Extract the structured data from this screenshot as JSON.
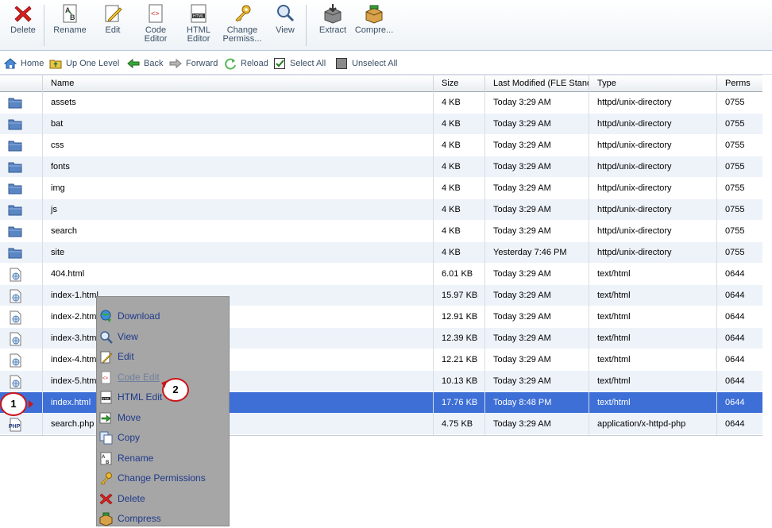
{
  "toolbar": {
    "buttons": [
      {
        "key": "delete",
        "label": "Delete",
        "icon": "red-x-icon"
      },
      {
        "key": "rename",
        "label": "Rename",
        "icon": "rename-ab-icon"
      },
      {
        "key": "edit",
        "label": "Edit",
        "icon": "pencil-page-icon"
      },
      {
        "key": "code-editor",
        "label1": "Code",
        "label2": "Editor",
        "icon": "code-page-icon"
      },
      {
        "key": "html-editor",
        "label1": "HTML",
        "label2": "Editor",
        "icon": "html-page-icon"
      },
      {
        "key": "change-permissions",
        "label1": "Change",
        "label2": "Permiss...",
        "icon": "key-icon"
      },
      {
        "key": "view",
        "label": "View",
        "icon": "magnifier-icon"
      },
      {
        "key": "extract",
        "label": "Extract",
        "icon": "extract-box-icon"
      },
      {
        "key": "compress",
        "label": "Compre...",
        "icon": "compress-box-icon"
      }
    ]
  },
  "navbar": {
    "home": "Home",
    "up": "Up One Level",
    "back": "Back",
    "forward": "Forward",
    "reload": "Reload",
    "select_all": "Select All",
    "unselect_all": "Unselect All"
  },
  "table": {
    "headers": {
      "name": "Name",
      "size": "Size",
      "modified": "Last Modified (FLE Stand",
      "type": "Type",
      "perms": "Perms"
    },
    "rows": [
      {
        "name": "assets",
        "size": "4 KB",
        "modified": "Today 3:29 AM",
        "type": "httpd/unix-directory",
        "perms": "0755",
        "kind": "folder"
      },
      {
        "name": "bat",
        "size": "4 KB",
        "modified": "Today 3:29 AM",
        "type": "httpd/unix-directory",
        "perms": "0755",
        "kind": "folder"
      },
      {
        "name": "css",
        "size": "4 KB",
        "modified": "Today 3:29 AM",
        "type": "httpd/unix-directory",
        "perms": "0755",
        "kind": "folder"
      },
      {
        "name": "fonts",
        "size": "4 KB",
        "modified": "Today 3:29 AM",
        "type": "httpd/unix-directory",
        "perms": "0755",
        "kind": "folder"
      },
      {
        "name": "img",
        "size": "4 KB",
        "modified": "Today 3:29 AM",
        "type": "httpd/unix-directory",
        "perms": "0755",
        "kind": "folder"
      },
      {
        "name": "js",
        "size": "4 KB",
        "modified": "Today 3:29 AM",
        "type": "httpd/unix-directory",
        "perms": "0755",
        "kind": "folder"
      },
      {
        "name": "search",
        "size": "4 KB",
        "modified": "Today 3:29 AM",
        "type": "httpd/unix-directory",
        "perms": "0755",
        "kind": "folder"
      },
      {
        "name": "site",
        "size": "4 KB",
        "modified": "Yesterday 7:46 PM",
        "type": "httpd/unix-directory",
        "perms": "0755",
        "kind": "folder"
      },
      {
        "name": "404.html",
        "size": "6.01 KB",
        "modified": "Today 3:29 AM",
        "type": "text/html",
        "perms": "0644",
        "kind": "html"
      },
      {
        "name": "index-1.html",
        "size": "15.97 KB",
        "modified": "Today 3:29 AM",
        "type": "text/html",
        "perms": "0644",
        "kind": "html"
      },
      {
        "name": "index-2.html",
        "size": "12.91 KB",
        "modified": "Today 3:29 AM",
        "type": "text/html",
        "perms": "0644",
        "kind": "html"
      },
      {
        "name": "index-3.html",
        "size": "12.39 KB",
        "modified": "Today 3:29 AM",
        "type": "text/html",
        "perms": "0644",
        "kind": "html"
      },
      {
        "name": "index-4.html",
        "size": "12.21 KB",
        "modified": "Today 3:29 AM",
        "type": "text/html",
        "perms": "0644",
        "kind": "html"
      },
      {
        "name": "index-5.html",
        "size": "10.13 KB",
        "modified": "Today 3:29 AM",
        "type": "text/html",
        "perms": "0644",
        "kind": "html"
      },
      {
        "name": "index.html",
        "size": "17.76 KB",
        "modified": "Today 8:48 PM",
        "type": "text/html",
        "perms": "0644",
        "kind": "html",
        "selected": true
      },
      {
        "name": "search.php",
        "size": "4.75 KB",
        "modified": "Today 3:29 AM",
        "type": "application/x-httpd-php",
        "perms": "0644",
        "kind": "php"
      }
    ]
  },
  "context_menu": {
    "items": [
      {
        "key": "download",
        "label": "Download",
        "icon": "globe-download-icon"
      },
      {
        "key": "view",
        "label": "View",
        "icon": "magnifier-icon"
      },
      {
        "key": "edit",
        "label": "Edit",
        "icon": "pencil-page-icon"
      },
      {
        "key": "code-edit",
        "label": "Code Edit",
        "icon": "code-page-icon",
        "disabled": true
      },
      {
        "key": "html-edit",
        "label": "HTML Edit",
        "icon": "html-page-icon"
      },
      {
        "key": "move",
        "label": "Move",
        "icon": "move-arrow-icon"
      },
      {
        "key": "copy",
        "label": "Copy",
        "icon": "copy-pages-icon"
      },
      {
        "key": "rename",
        "label": "Rename",
        "icon": "rename-ab-icon"
      },
      {
        "key": "change-permissions",
        "label": "Change Permissions",
        "icon": "key-icon"
      },
      {
        "key": "delete",
        "label": "Delete",
        "icon": "red-x-icon"
      },
      {
        "key": "compress",
        "label": "Compress",
        "icon": "compress-box-icon"
      }
    ]
  },
  "callouts": [
    "1",
    "2"
  ],
  "colors": {
    "selection": "#3d6fd6",
    "row_alt": "#eef3fa",
    "menu_bg": "#a6a6a6",
    "menu_text": "#1f3a8a",
    "callout_border": "#c9161b"
  }
}
